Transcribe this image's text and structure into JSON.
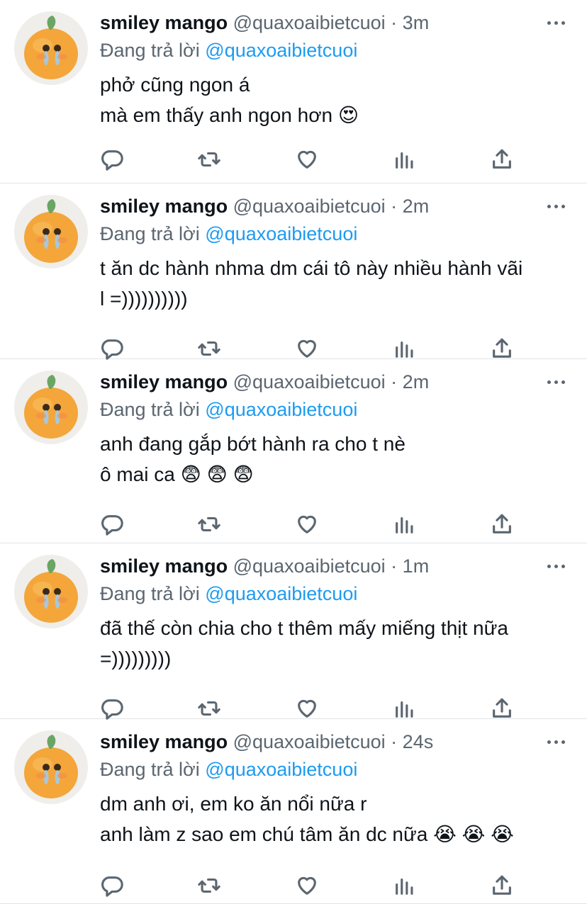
{
  "tweets": [
    {
      "name": "smiley mango",
      "handle": "@quaxoaibietcuoi",
      "separator": "·",
      "time": "3m",
      "replying_prefix": "Đang trả lời",
      "replying_to": "@quaxoaibietcuoi",
      "lines": [
        "phở cũng ngon á",
        "mà em thấy anh ngon hơn 😍"
      ]
    },
    {
      "name": "smiley mango",
      "handle": "@quaxoaibietcuoi",
      "separator": "·",
      "time": "2m",
      "replying_prefix": "Đang trả lời",
      "replying_to": "@quaxoaibietcuoi",
      "lines": [
        "t ăn dc hành nhma dm cái tô này nhiều hành vãi",
        "l =))))))))))"
      ]
    },
    {
      "name": "smiley mango",
      "handle": "@quaxoaibietcuoi",
      "separator": "·",
      "time": "2m",
      "replying_prefix": "Đang trả lời",
      "replying_to": "@quaxoaibietcuoi",
      "lines": [
        "anh đang gắp bớt hành ra cho t nè",
        "ô mai ca 😨 😨 😨"
      ]
    },
    {
      "name": "smiley mango",
      "handle": "@quaxoaibietcuoi",
      "separator": "·",
      "time": "1m",
      "replying_prefix": "Đang trả lời",
      "replying_to": "@quaxoaibietcuoi",
      "lines": [
        "đã thế còn chia cho t thêm mấy miếng thịt nữa",
        "=)))))))))"
      ]
    },
    {
      "name": "smiley mango",
      "handle": "@quaxoaibietcuoi",
      "separator": "·",
      "time": "24s",
      "replying_prefix": "Đang trả lời",
      "replying_to": "@quaxoaibietcuoi",
      "lines": [
        "dm anh ơi, em ko ăn nổi nữa r",
        "anh làm z sao em chú tâm ăn dc nữa 😭 😭 😭"
      ]
    }
  ],
  "icons": {
    "reply": "reply-icon",
    "retweet": "retweet-icon",
    "like": "heart-icon",
    "stats": "stats-icon",
    "share": "share-icon",
    "more": "more-icon",
    "avatar": "mango-avatar"
  },
  "colors": {
    "link": "#1d9bf0",
    "secondary_text": "#5b6670",
    "divider": "#e1e4e7",
    "mango": "#f4a63a",
    "leaf": "#6aa565"
  }
}
